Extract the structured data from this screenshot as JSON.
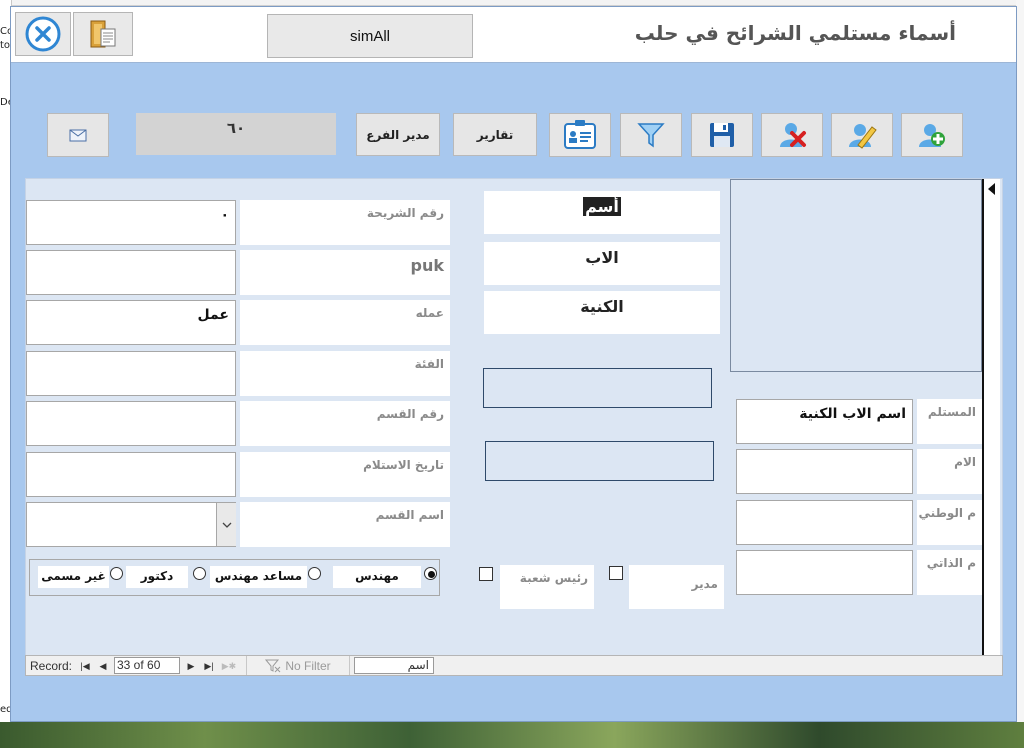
{
  "window": {
    "title": "أسماء مستلمي الشرائح في حلب",
    "simall_label": "simAll"
  },
  "desktop": {
    "left_fragments": [
      "Co",
      "to",
      "De",
      "ed"
    ]
  },
  "toolbar": {
    "counter": "٦٠",
    "branch_manager": "مدير الفرع",
    "reports": "تقارير",
    "icons": [
      "mail-icon",
      "id-card-icon",
      "filter-icon",
      "save-icon",
      "delete-user-icon",
      "edit-icon",
      "add-user-icon"
    ]
  },
  "form": {
    "name_cells": {
      "first": "أسم",
      "father": "الاب",
      "surname": "الكنية"
    },
    "labels": {
      "chip_number": "رقم الشريحة",
      "puk": "puk",
      "work": "عمله",
      "category": "الفئة",
      "dept_number": "رقم القسم",
      "receive_date": "تاريخ الاستلام",
      "dept_name": "اسم القسم",
      "recipient": "المستلم",
      "mother": "الام",
      "national": "م الوطني",
      "self": "م الذاتي",
      "section_head": "رئيس شعبة",
      "manager": "مدير"
    },
    "values": {
      "chip_number": "٠",
      "work": "عمل",
      "recipient": "اسم الاب الكنية"
    },
    "roles": [
      {
        "label": "مهندس",
        "selected": true
      },
      {
        "label": "مساعد مهندس",
        "selected": false
      },
      {
        "label": "دكتور",
        "selected": false
      },
      {
        "label": "غير مسمى",
        "selected": false
      }
    ]
  },
  "navigator": {
    "record_label": "Record:",
    "record_value": "33 of 60",
    "no_filter": "No Filter",
    "search_value": "اسم"
  }
}
